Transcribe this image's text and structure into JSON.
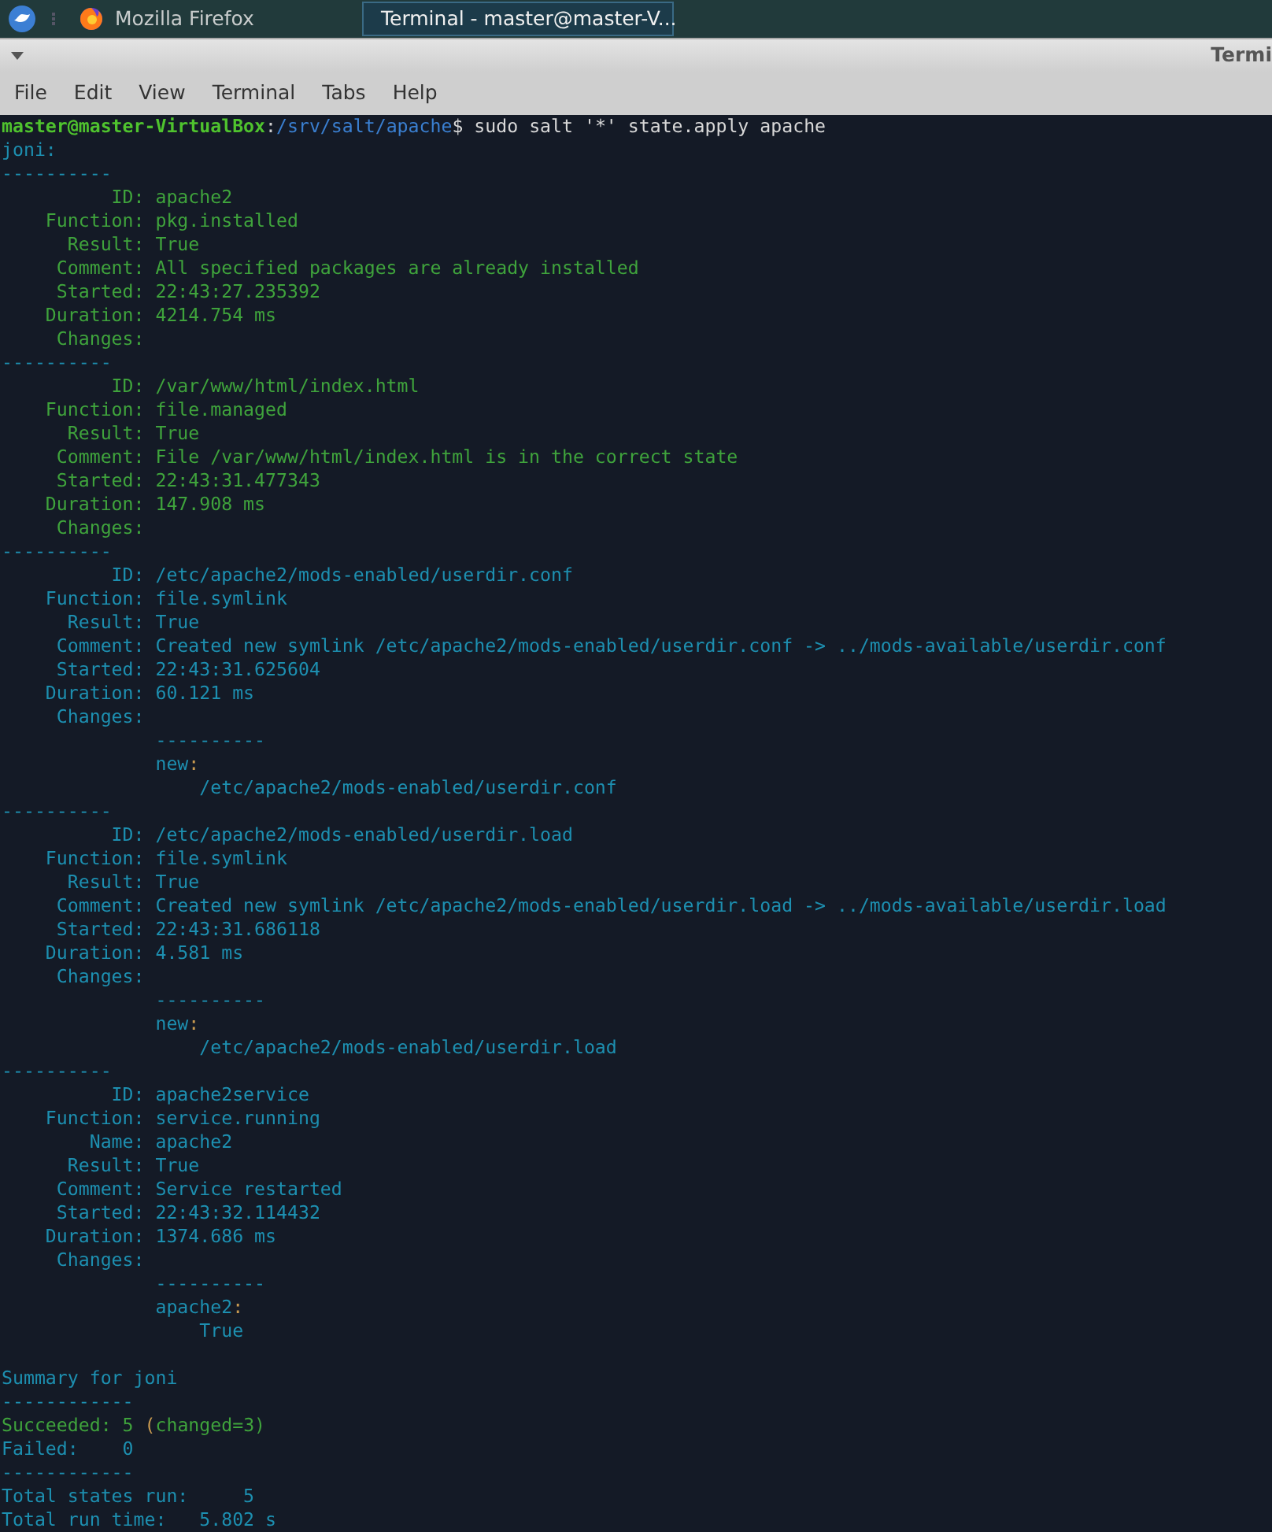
{
  "taskbar": {
    "tasks": [
      {
        "kind": "firefox",
        "label": "Mozilla Firefox",
        "selected": false
      },
      {
        "kind": "terminal",
        "label": "Terminal - master@master-V...",
        "selected": true
      }
    ]
  },
  "window": {
    "title": "Termi"
  },
  "menu": [
    "File",
    "Edit",
    "View",
    "Terminal",
    "Tabs",
    "Help"
  ],
  "terminal": {
    "prompt": {
      "user": "master@master-VirtualBox",
      "separator": ":",
      "path": "/srv/salt/apache",
      "command": "$ sudo salt '*' state.apply apache"
    },
    "lines": [
      [
        {
          "text": "joni:",
          "color": "#1d8fb0"
        }
      ],
      [
        {
          "text": "----------",
          "color": "#1d8fb0"
        }
      ],
      [
        {
          "text": "          ID: apache2",
          "color": "#3fa33c"
        }
      ],
      [
        {
          "text": "    Function: pkg.installed",
          "color": "#3fa33c"
        }
      ],
      [
        {
          "text": "      Result: True",
          "color": "#3fa33c"
        }
      ],
      [
        {
          "text": "     Comment: All specified packages are already installed",
          "color": "#3fa33c"
        }
      ],
      [
        {
          "text": "     Started: 22:43:27.235392",
          "color": "#3fa33c"
        }
      ],
      [
        {
          "text": "    Duration: 4214.754 ms",
          "color": "#3fa33c"
        }
      ],
      [
        {
          "text": "     Changes:",
          "color": "#3fa33c"
        }
      ],
      [
        {
          "text": "----------",
          "color": "#1d8fb0"
        }
      ],
      [
        {
          "text": "          ID: /var/www/html/index.html",
          "color": "#3fa33c"
        }
      ],
      [
        {
          "text": "    Function: file.managed",
          "color": "#3fa33c"
        }
      ],
      [
        {
          "text": "      Result: True",
          "color": "#3fa33c"
        }
      ],
      [
        {
          "text": "     Comment: File /var/www/html/index.html is in the correct state",
          "color": "#3fa33c"
        }
      ],
      [
        {
          "text": "     Started: 22:43:31.477343",
          "color": "#3fa33c"
        }
      ],
      [
        {
          "text": "    Duration: 147.908 ms",
          "color": "#3fa33c"
        }
      ],
      [
        {
          "text": "     Changes:",
          "color": "#3fa33c"
        }
      ],
      [
        {
          "text": "----------",
          "color": "#1d8fb0"
        }
      ],
      [
        {
          "text": "          ID: /etc/apache2/mods-enabled/userdir.conf",
          "color": "#1d8fb0"
        }
      ],
      [
        {
          "text": "    Function: file.symlink",
          "color": "#1d8fb0"
        }
      ],
      [
        {
          "text": "      Result: True",
          "color": "#1d8fb0"
        }
      ],
      [
        {
          "text": "     Comment: Created new symlink /etc/apache2/mods-enabled/userdir.conf -> ../mods-available/userdir.conf",
          "color": "#1d8fb0"
        }
      ],
      [
        {
          "text": "     Started: 22:43:31.625604",
          "color": "#1d8fb0"
        }
      ],
      [
        {
          "text": "    Duration: 60.121 ms",
          "color": "#1d8fb0"
        }
      ],
      [
        {
          "text": "     Changes:",
          "color": "#1d8fb0"
        }
      ],
      [
        {
          "text": "              ----------",
          "color": "#1d8fb0"
        }
      ],
      [
        {
          "text": "              new",
          "color": "#1d8fb0"
        },
        {
          "text": ":",
          "color": "#c89a50"
        }
      ],
      [
        {
          "text": "                  /etc/apache2/mods-enabled/userdir.conf",
          "color": "#1d8fb0"
        }
      ],
      [
        {
          "text": "----------",
          "color": "#1d8fb0"
        }
      ],
      [
        {
          "text": "          ID: /etc/apache2/mods-enabled/userdir.load",
          "color": "#1d8fb0"
        }
      ],
      [
        {
          "text": "    Function: file.symlink",
          "color": "#1d8fb0"
        }
      ],
      [
        {
          "text": "      Result: True",
          "color": "#1d8fb0"
        }
      ],
      [
        {
          "text": "     Comment: Created new symlink /etc/apache2/mods-enabled/userdir.load -> ../mods-available/userdir.load",
          "color": "#1d8fb0"
        }
      ],
      [
        {
          "text": "     Started: 22:43:31.686118",
          "color": "#1d8fb0"
        }
      ],
      [
        {
          "text": "    Duration: 4.581 ms",
          "color": "#1d8fb0"
        }
      ],
      [
        {
          "text": "     Changes:",
          "color": "#1d8fb0"
        }
      ],
      [
        {
          "text": "              ----------",
          "color": "#1d8fb0"
        }
      ],
      [
        {
          "text": "              new",
          "color": "#1d8fb0"
        },
        {
          "text": ":",
          "color": "#c89a50"
        }
      ],
      [
        {
          "text": "                  /etc/apache2/mods-enabled/userdir.load",
          "color": "#1d8fb0"
        }
      ],
      [
        {
          "text": "----------",
          "color": "#1d8fb0"
        }
      ],
      [
        {
          "text": "          ID: apache2service",
          "color": "#1d8fb0"
        }
      ],
      [
        {
          "text": "    Function: service.running",
          "color": "#1d8fb0"
        }
      ],
      [
        {
          "text": "        Name: apache2",
          "color": "#1d8fb0"
        }
      ],
      [
        {
          "text": "      Result: True",
          "color": "#1d8fb0"
        }
      ],
      [
        {
          "text": "     Comment: Service restarted",
          "color": "#1d8fb0"
        }
      ],
      [
        {
          "text": "     Started: 22:43:32.114432",
          "color": "#1d8fb0"
        }
      ],
      [
        {
          "text": "    Duration: 1374.686 ms",
          "color": "#1d8fb0"
        }
      ],
      [
        {
          "text": "     Changes:",
          "color": "#1d8fb0"
        }
      ],
      [
        {
          "text": "              ----------",
          "color": "#1d8fb0"
        }
      ],
      [
        {
          "text": "              apache2",
          "color": "#1d8fb0"
        },
        {
          "text": ":",
          "color": "#c89a50"
        }
      ],
      [
        {
          "text": "                  True",
          "color": "#1d8fb0"
        }
      ]
    ],
    "summary": [
      [
        {
          "text": "Summary for joni",
          "color": "#1d8fb0"
        }
      ],
      [
        {
          "text": "------------",
          "color": "#1d8fb0"
        }
      ],
      [
        {
          "text": "Succeeded: 5 ",
          "color": "#3fa33c"
        },
        {
          "text": "(",
          "color": "#c89a50"
        },
        {
          "text": "changed=3)",
          "color": "#3fa33c"
        }
      ],
      [
        {
          "text": "Failed:    0",
          "color": "#1d8fb0"
        }
      ],
      [
        {
          "text": "------------",
          "color": "#1d8fb0"
        }
      ],
      [
        {
          "text": "Total states run:     5",
          "color": "#1d8fb0"
        }
      ],
      [
        {
          "text": "Total run time:   5.802 s",
          "color": "#1d8fb0"
        }
      ]
    ]
  }
}
